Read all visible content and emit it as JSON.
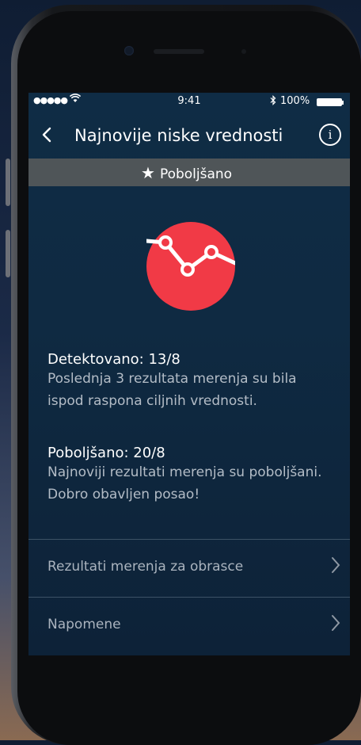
{
  "status_bar": {
    "signal": "●●●●●",
    "wifi_icon": "wifi-icon",
    "time": "9:41",
    "bluetooth_icon": "bluetooth-icon",
    "battery_percent": "100%"
  },
  "nav": {
    "back_icon": "chevron-left-icon",
    "title": "Najnovije niske vrednosti",
    "info_icon": "info-icon"
  },
  "banner": {
    "icon": "star-icon",
    "label": "Poboljšano"
  },
  "logo": {
    "icon": "trend-down-up-icon",
    "color": "#f13a46"
  },
  "detected": {
    "title": "Detektovano: 13/8",
    "line1": "Poslednja 3 rezultata merenja su bila",
    "line2": "ispod raspona ciljnih vrednosti."
  },
  "improved": {
    "title": "Poboljšano: 20/8",
    "line1": "Najnoviji rezultati merenja su poboljšani.",
    "line2": "Dobro obavljen posao!"
  },
  "rows": [
    {
      "label": "Rezultati merenja za obrasce",
      "icon": "chevron-right-icon"
    },
    {
      "label": "Napomene",
      "icon": "chevron-right-icon"
    }
  ]
}
